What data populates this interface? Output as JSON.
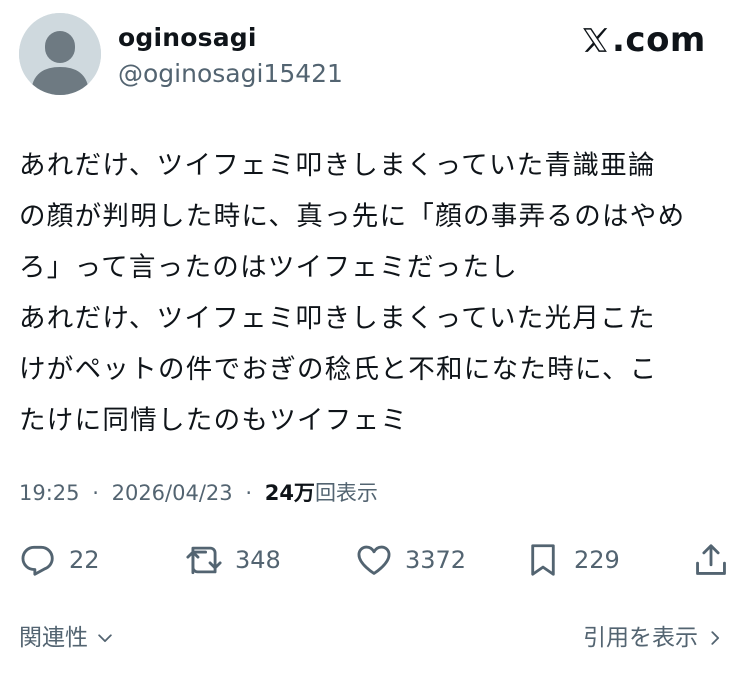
{
  "author": {
    "display_name": "oginosagi",
    "handle": "@oginosagi15421",
    "avatar_icon": "default-avatar-icon"
  },
  "brand": {
    "text": ".com",
    "icon": "x-logo-icon"
  },
  "post": {
    "lines": [
      "あれだけ、ツイフェミ叩きしまくっていた青識亜論",
      "の顔が判明した時に、真っ先に「顔の事弄るのはやめ",
      "ろ」って言ったのはツイフェミだったし",
      "あれだけ、ツイフェミ叩きしまくっていた光月こた",
      "けがペットの件でおぎの稔氏と不和になた時に、こ",
      "たけに同情したのもツイフェミ"
    ]
  },
  "meta": {
    "time": "19:25",
    "separator": "·",
    "date": "2026/04/23",
    "views_count": "24万",
    "views_label": "回表示"
  },
  "actions": {
    "replies": "22",
    "reposts": "348",
    "likes": "3372",
    "bookmarks": "229"
  },
  "footer": {
    "related": "関連性",
    "quote": "引用を表示"
  },
  "colors": {
    "text": "#0f1419",
    "secondary": "#536471",
    "avatar_bg": "#cfd9de",
    "avatar_fg": "#6e7a82"
  }
}
